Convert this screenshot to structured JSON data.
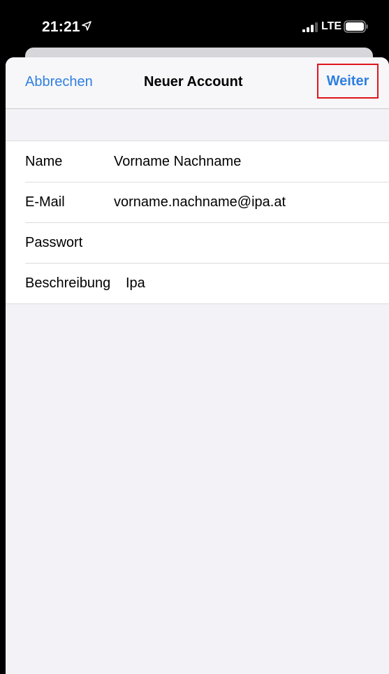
{
  "status_bar": {
    "time": "21:21",
    "network": "LTE"
  },
  "nav": {
    "cancel_label": "Abbrechen",
    "title": "Neuer Account",
    "next_label": "Weiter"
  },
  "form": {
    "rows": [
      {
        "label": "Name",
        "value": "Vorname Nachname"
      },
      {
        "label": "E-Mail",
        "value": "vorname.nachname@ipa.at"
      },
      {
        "label": "Passwort",
        "value": ""
      },
      {
        "label": "Beschreibung",
        "value": "Ipa"
      }
    ]
  },
  "colors": {
    "accent": "#2f7fe0",
    "highlight_border": "#e0151e",
    "background": "#f2f2f7"
  },
  "icons": [
    "location-arrow-icon",
    "cellular-signal-icon",
    "battery-icon"
  ]
}
